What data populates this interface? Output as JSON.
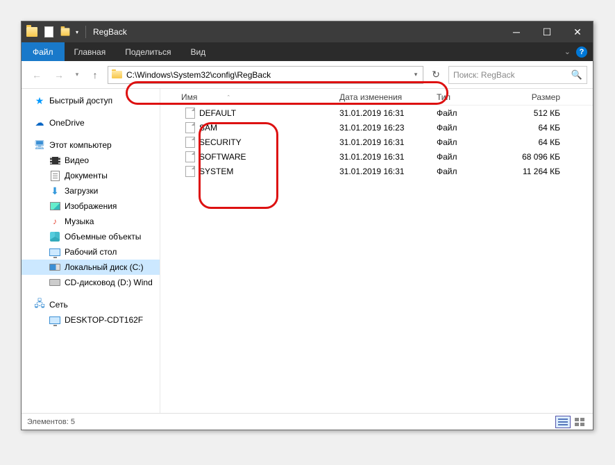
{
  "titlebar": {
    "title": "RegBack"
  },
  "ribbon": {
    "file": "Файл",
    "tabs": [
      "Главная",
      "Поделиться",
      "Вид"
    ]
  },
  "nav": {
    "address": "C:\\Windows\\System32\\config\\RegBack",
    "search_placeholder": "Поиск: RegBack"
  },
  "sidebar": {
    "quick": "Быстрый доступ",
    "onedrive": "OneDrive",
    "thispc": "Этот компьютер",
    "network": "Сеть",
    "pc_items": [
      {
        "label": "Видео",
        "icon": "video"
      },
      {
        "label": "Документы",
        "icon": "doc"
      },
      {
        "label": "Загрузки",
        "icon": "down"
      },
      {
        "label": "Изображения",
        "icon": "img"
      },
      {
        "label": "Музыка",
        "icon": "note"
      },
      {
        "label": "Объемные объекты",
        "icon": "threed"
      },
      {
        "label": "Рабочий стол",
        "icon": "monitor"
      },
      {
        "label": "Локальный диск (C:)",
        "icon": "drivec",
        "selected": true
      },
      {
        "label": "CD-дисковод (D:) Wind",
        "icon": "drive"
      }
    ],
    "net_items": [
      {
        "label": "DESKTOP-CDT162F",
        "icon": "monitor"
      }
    ]
  },
  "columns": {
    "name": "Имя",
    "date": "Дата изменения",
    "type": "Тип",
    "size": "Размер"
  },
  "files": [
    {
      "name": "DEFAULT",
      "date": "31.01.2019 16:31",
      "type": "Файл",
      "size": "512 КБ"
    },
    {
      "name": "SAM",
      "date": "31.01.2019 16:23",
      "type": "Файл",
      "size": "64 КБ"
    },
    {
      "name": "SECURITY",
      "date": "31.01.2019 16:31",
      "type": "Файл",
      "size": "64 КБ"
    },
    {
      "name": "SOFTWARE",
      "date": "31.01.2019 16:31",
      "type": "Файл",
      "size": "68 096 КБ"
    },
    {
      "name": "SYSTEM",
      "date": "31.01.2019 16:31",
      "type": "Файл",
      "size": "11 264 КБ"
    }
  ],
  "status": "Элементов: 5"
}
